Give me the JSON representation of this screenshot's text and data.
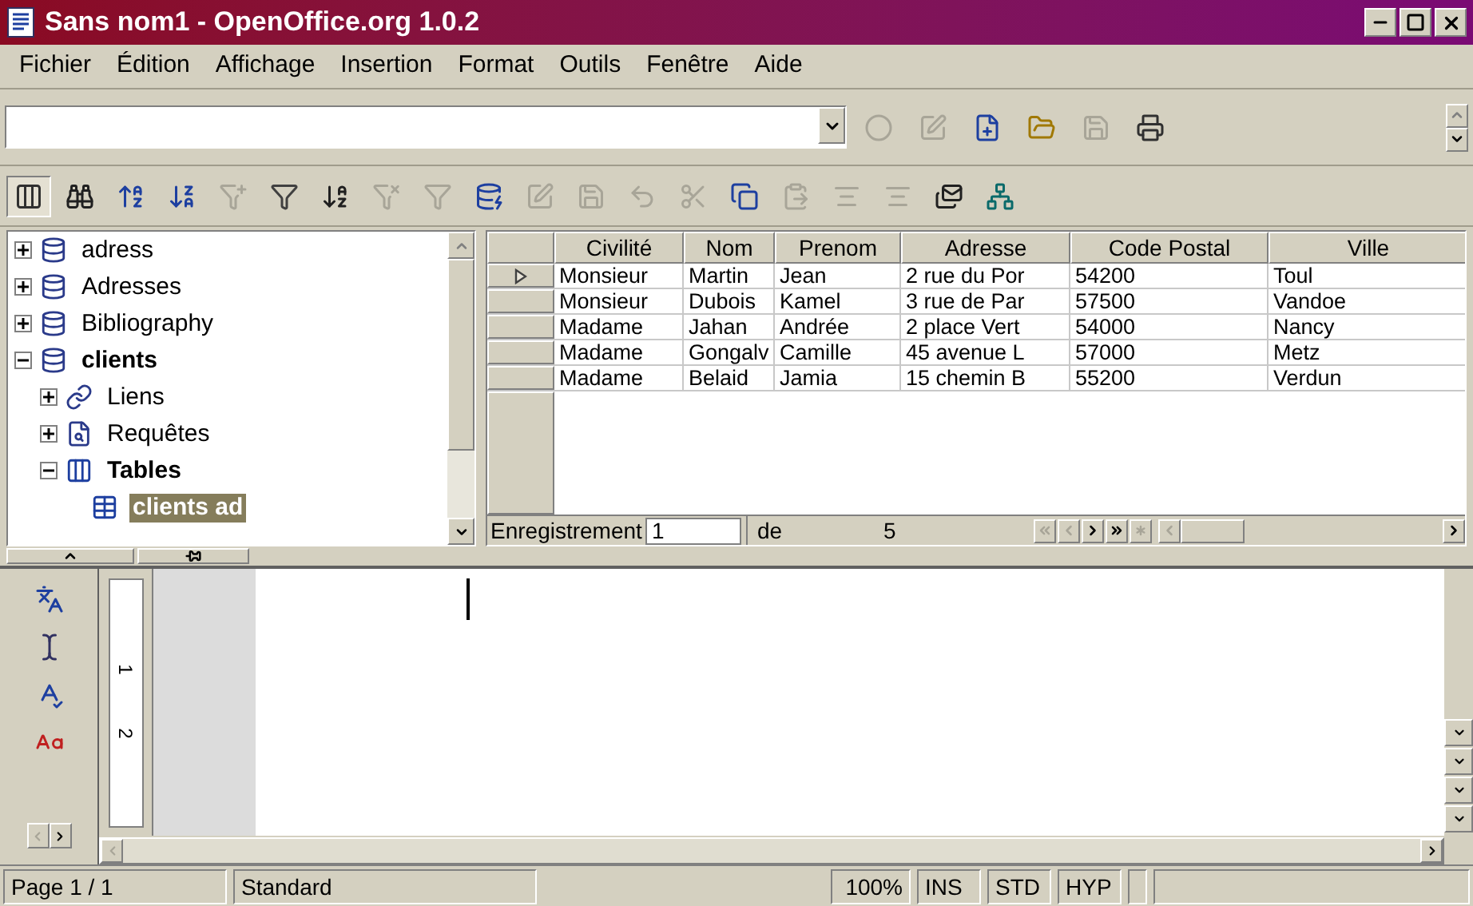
{
  "window": {
    "title": "Sans nom1 - OpenOffice.org 1.0.2"
  },
  "menu": [
    "Fichier",
    "Édition",
    "Affichage",
    "Insertion",
    "Format",
    "Outils",
    "Fenêtre",
    "Aide"
  ],
  "toolbar_top": [
    {
      "kind": "record",
      "disabled": true
    },
    {
      "kind": "edit",
      "disabled": true
    },
    {
      "kind": "new",
      "disabled": false
    },
    {
      "kind": "open",
      "disabled": false
    },
    {
      "kind": "save",
      "disabled": true
    },
    {
      "kind": "print",
      "disabled": false
    }
  ],
  "toolbar_data": [
    {
      "kind": "explorer",
      "disabled": false,
      "selected": true
    },
    {
      "kind": "find",
      "disabled": false,
      "selected": false
    },
    {
      "kind": "sort-asc",
      "disabled": false,
      "selected": false
    },
    {
      "kind": "sort-desc",
      "disabled": false,
      "selected": false
    },
    {
      "kind": "autofilter",
      "disabled": true,
      "selected": false
    },
    {
      "kind": "filter",
      "disabled": false,
      "selected": false
    },
    {
      "kind": "sort",
      "disabled": false,
      "selected": false
    },
    {
      "kind": "remove-filter",
      "disabled": true,
      "selected": false
    },
    {
      "kind": "filter",
      "disabled": true,
      "selected": false
    },
    {
      "kind": "data-to-text",
      "disabled": false,
      "selected": false
    },
    {
      "kind": "edit",
      "disabled": true,
      "selected": false
    },
    {
      "kind": "save",
      "disabled": true,
      "selected": false
    },
    {
      "kind": "undo",
      "disabled": true,
      "selected": false
    },
    {
      "kind": "cut",
      "disabled": true,
      "selected": false
    },
    {
      "kind": "copy",
      "disabled": false,
      "selected": false
    },
    {
      "kind": "paste",
      "disabled": true,
      "selected": false
    },
    {
      "kind": "align",
      "disabled": true,
      "selected": false
    },
    {
      "kind": "align",
      "disabled": true,
      "selected": false
    },
    {
      "kind": "mail",
      "disabled": false,
      "selected": false
    },
    {
      "kind": "source",
      "disabled": false,
      "selected": false
    }
  ],
  "tree": [
    {
      "label": "adress",
      "kind": "database",
      "expanded": false,
      "selected": false
    },
    {
      "label": "Adresses",
      "kind": "database",
      "expanded": false,
      "selected": false
    },
    {
      "label": "Bibliography",
      "kind": "database",
      "expanded": false,
      "selected": false
    },
    {
      "label": "clients",
      "kind": "database",
      "expanded": true,
      "selected": false,
      "children": [
        {
          "label": "Liens",
          "kind": "links",
          "expanded": false,
          "selected": false
        },
        {
          "label": "Requêtes",
          "kind": "queries",
          "expanded": false,
          "selected": false
        },
        {
          "label": "Tables",
          "kind": "tables",
          "expanded": true,
          "selected": false,
          "children": [
            {
              "label": "clients ad",
              "kind": "table",
              "selected": true
            }
          ]
        }
      ]
    }
  ],
  "table": {
    "columns": [
      "Civilité",
      "Nom",
      "Prenom",
      "Adresse",
      "Code Postal",
      "Ville"
    ],
    "rows": [
      {
        "selected": true,
        "cells": [
          "Monsieur",
          "Martin",
          "Jean",
          "2 rue du Por",
          "54200",
          "Toul"
        ]
      },
      {
        "selected": false,
        "cells": [
          "Monsieur",
          "Dubois",
          "Kamel",
          "3 rue de Par",
          "57500",
          "Vandoe"
        ]
      },
      {
        "selected": false,
        "cells": [
          "Madame",
          "Jahan",
          "Andrée",
          "2 place Vert",
          "54000",
          "Nancy"
        ]
      },
      {
        "selected": false,
        "cells": [
          "Madame",
          "Gongalv",
          "Camille",
          "45 avenue L",
          "57000",
          "Metz"
        ]
      },
      {
        "selected": false,
        "cells": [
          "Madame",
          "Belaid",
          "Jamia",
          "15 chemin B",
          "55200",
          "Verdun"
        ]
      }
    ]
  },
  "record_nav": {
    "label": "Enregistrement",
    "value": "1",
    "of_label": "de",
    "total": "5"
  },
  "ruler_labels": [
    "1",
    "2"
  ],
  "status_bar": [
    "Page 1 / 1",
    "Standard",
    "100%",
    "INS",
    "STD",
    "HYP"
  ]
}
